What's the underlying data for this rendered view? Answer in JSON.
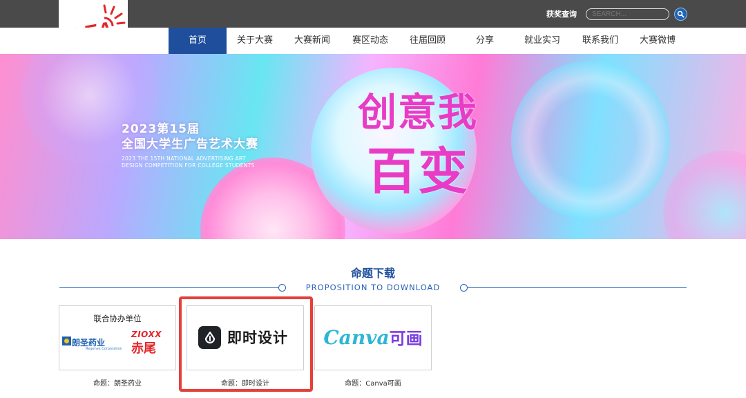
{
  "header": {
    "logo_text": "IDEA",
    "awards_link": "获奖查询",
    "search_placeholder": "SEARCH..."
  },
  "nav": {
    "items": [
      {
        "label": "首页",
        "active": true
      },
      {
        "label": "关于大赛",
        "active": false
      },
      {
        "label": "大赛新闻",
        "active": false
      },
      {
        "label": "赛区动态",
        "active": false
      },
      {
        "label": "往届回顾",
        "active": false
      },
      {
        "label": "分享",
        "active": false
      },
      {
        "label": "就业实习",
        "active": false
      },
      {
        "label": "联系我们",
        "active": false
      },
      {
        "label": "大赛微博",
        "active": false
      }
    ]
  },
  "banner": {
    "title_line1": "2023第15届",
    "title_line2": "全国大学生广告艺术大赛",
    "en_line1": "2023 THE 15TH NATIONAL ADVERTISING ART",
    "en_line2": "DESIGN COMPETITION FOR COLLEGE STUDENTS",
    "slogan_line1": "创意我",
    "slogan_line2": "百变"
  },
  "section": {
    "title": "命题下载",
    "subtitle": "PROPOSITION TO DOWNLOAD"
  },
  "cards": [
    {
      "header": "联合协办单位",
      "logo1": "朗圣药业",
      "logo1_sub": "Regenex Corporation",
      "logo2_top": "ZIOXX",
      "logo2": "赤尾",
      "caption": "命题：朗圣药业"
    },
    {
      "logo": "即时设计",
      "caption": "命题：即时设计",
      "highlighted": true
    },
    {
      "logo_en": "Canva",
      "logo_cn": "可画",
      "caption": "命题：Canva可画"
    }
  ],
  "colors": {
    "nav_active": "#1e4e9c",
    "top_bar": "#4a4a4a",
    "accent_blue": "#2a62b8",
    "highlight_red": "#e5403a"
  }
}
